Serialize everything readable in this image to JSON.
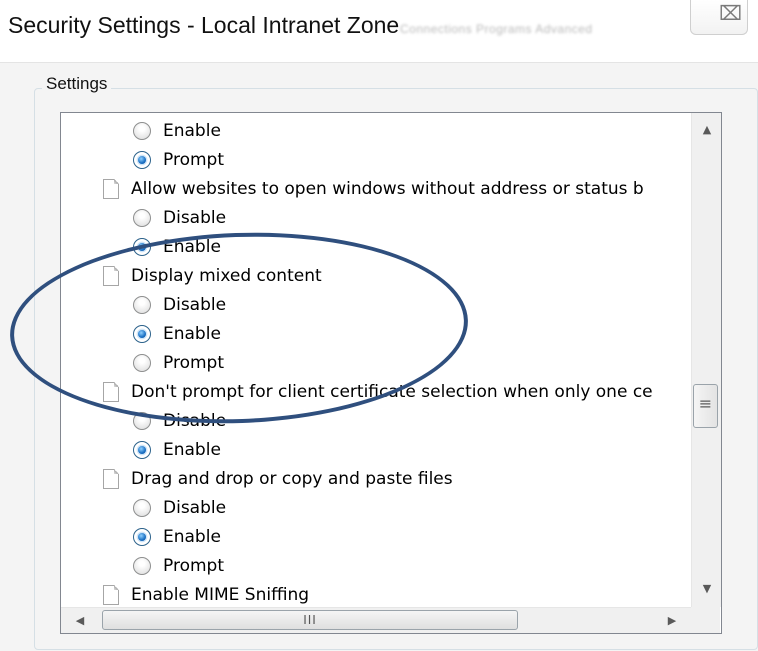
{
  "window": {
    "title": "Security Settings - Local Intranet Zone",
    "background_tabs": "Connections   Programs   Advanced",
    "close_glyph": "⌧"
  },
  "group": {
    "label": "Settings"
  },
  "settings_list": [
    {
      "kind": "option",
      "label": "Enable",
      "checked": false
    },
    {
      "kind": "option",
      "label": "Prompt",
      "checked": true
    },
    {
      "kind": "setting",
      "label": "Allow websites to open windows without address or status b"
    },
    {
      "kind": "option",
      "label": "Disable",
      "checked": false
    },
    {
      "kind": "option",
      "label": "Enable",
      "checked": true
    },
    {
      "kind": "setting",
      "label": "Display mixed content"
    },
    {
      "kind": "option",
      "label": "Disable",
      "checked": false
    },
    {
      "kind": "option",
      "label": "Enable",
      "checked": true
    },
    {
      "kind": "option",
      "label": "Prompt",
      "checked": false
    },
    {
      "kind": "setting",
      "label": "Don't prompt for client certificate selection when only one ce"
    },
    {
      "kind": "option",
      "label": "Disable",
      "checked": false
    },
    {
      "kind": "option",
      "label": "Enable",
      "checked": true
    },
    {
      "kind": "setting",
      "label": "Drag and drop or copy and paste files"
    },
    {
      "kind": "option",
      "label": "Disable",
      "checked": false
    },
    {
      "kind": "option",
      "label": "Enable",
      "checked": true
    },
    {
      "kind": "option",
      "label": "Prompt",
      "checked": false
    },
    {
      "kind": "setting",
      "label": "Enable MIME Sniffing"
    }
  ],
  "scrollbars": {
    "vertical": {
      "up": "▲",
      "down": "▼",
      "grip": "≡"
    },
    "horizontal": {
      "left": "◀",
      "right": "▶",
      "grip": "III"
    }
  },
  "annotation": {
    "color": "#2f4f7e"
  }
}
